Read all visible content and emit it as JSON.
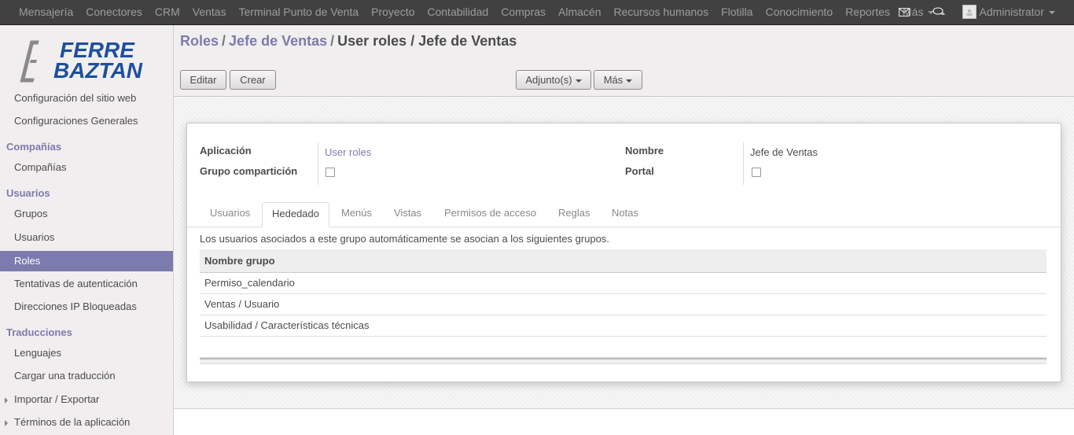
{
  "topbar": {
    "menu": [
      "Mensajería",
      "Conectores",
      "CRM",
      "Ventas",
      "Terminal Punto de Venta",
      "Proyecto",
      "Contabilidad",
      "Compras",
      "Almacén",
      "Recursos humanos",
      "Flotilla",
      "Conocimiento",
      "Reportes"
    ],
    "more_label": "Más",
    "user_name": "Administrator"
  },
  "logo": {
    "line1": "FERRE",
    "line2": "BAZTAN"
  },
  "sidebar": {
    "partial_item": "Configuración del sitio web",
    "item_config_general": "Configuraciones Generales",
    "sec_companias": "Compañías",
    "item_companias": "Compañías",
    "sec_usuarios": "Usuarios",
    "item_grupos": "Grupos",
    "item_usuarios": "Usuarios",
    "item_roles": "Roles",
    "item_tentativas": "Tentativas de autenticación",
    "item_ip": "Direcciones IP Bloqueadas",
    "sec_traducciones": "Traducciones",
    "item_lenguajes": "Lenguajes",
    "item_cargar": "Cargar una traducción",
    "item_importar": "Importar / Exportar",
    "item_terminos": "Términos de la aplicación"
  },
  "breadcrumb": {
    "b1": "Roles",
    "b2": "Jefe de Ventas",
    "current": "User roles / Jefe de Ventas",
    "sep": "/"
  },
  "buttons": {
    "edit": "Editar",
    "create": "Crear",
    "attachments": "Adjunto(s)",
    "more": "Más"
  },
  "form": {
    "app_label": "Aplicación",
    "app_value": "User roles",
    "share_label": "Grupo compartición",
    "share_checked": false,
    "name_label": "Nombre",
    "name_value": "Jefe de Ventas",
    "portal_label": "Portal",
    "portal_checked": false
  },
  "tabs": [
    "Usuarios",
    "Hededado",
    "Menús",
    "Vistas",
    "Permisos de acceso",
    "Reglas",
    "Notas"
  ],
  "active_tab": "Hededado",
  "inherited": {
    "description": "Los usuarios asociados a este grupo automáticamente se asocian a los siguientes grupos.",
    "column_header": "Nombre grupo",
    "rows": [
      "Permiso_calendario",
      "Ventas / Usuario",
      "Usabilidad / Características técnicas"
    ]
  }
}
